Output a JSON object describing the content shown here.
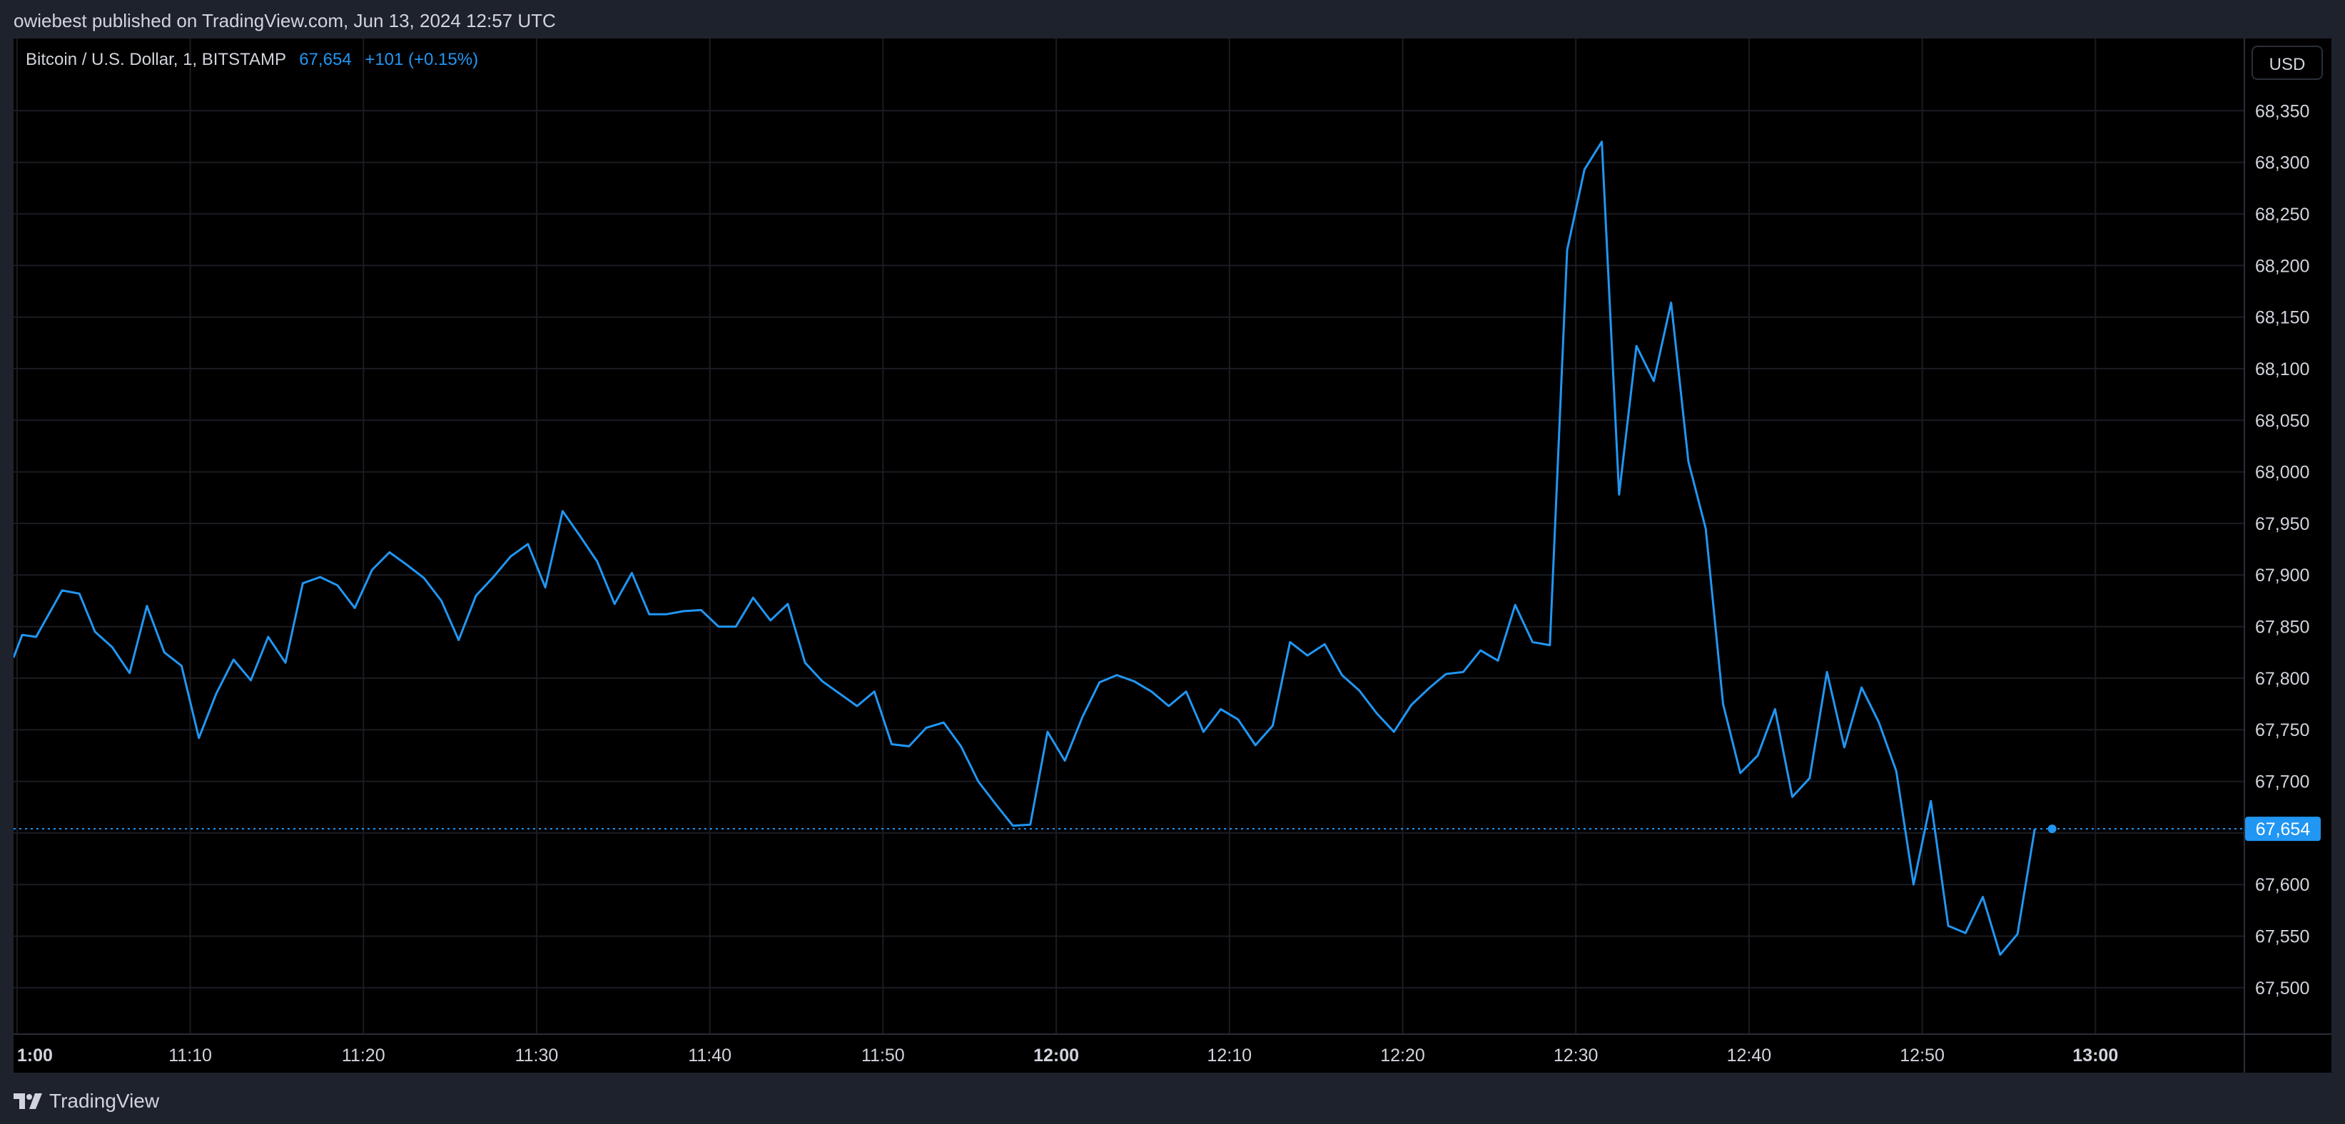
{
  "header": {
    "publish_line": "owiebest published on TradingView.com, Jun 13, 2024 12:57 UTC"
  },
  "legend": {
    "symbol": "Bitcoin / U.S. Dollar, 1, BITSTAMP",
    "price": "67,654",
    "change": "+101 (+0.15%)"
  },
  "currency_button": {
    "label": "USD"
  },
  "footer": {
    "brand": "TradingView"
  },
  "colors": {
    "line": "#2196f3",
    "price_tag_bg": "#2196f3",
    "background": "#000000",
    "frame": "#1e222d",
    "grid": "#1a1c22"
  },
  "chart_data": {
    "type": "line",
    "ylim": [
      67455,
      68420
    ],
    "x_tick_labels": [
      {
        "t": 0,
        "label": "1:00",
        "bold": true
      },
      {
        "t": 10,
        "label": "11:10",
        "bold": false
      },
      {
        "t": 20,
        "label": "11:20",
        "bold": false
      },
      {
        "t": 30,
        "label": "11:30",
        "bold": false
      },
      {
        "t": 40,
        "label": "11:40",
        "bold": false
      },
      {
        "t": 50,
        "label": "11:50",
        "bold": false
      },
      {
        "t": 60,
        "label": "12:00",
        "bold": true
      },
      {
        "t": 70,
        "label": "12:10",
        "bold": false
      },
      {
        "t": 80,
        "label": "12:20",
        "bold": false
      },
      {
        "t": 90,
        "label": "12:30",
        "bold": false
      },
      {
        "t": 100,
        "label": "12:40",
        "bold": false
      },
      {
        "t": 110,
        "label": "12:50",
        "bold": false
      },
      {
        "t": 120,
        "label": "13:00",
        "bold": true
      }
    ],
    "y_ticks": [
      67500,
      67550,
      67600,
      67700,
      67750,
      67800,
      67850,
      67900,
      67950,
      68000,
      68050,
      68100,
      68150,
      68200,
      68250,
      68300,
      68350
    ],
    "y_tick_labels": [
      "67,500",
      "67,550",
      "67,600",
      "67,700",
      "67,750",
      "67,800",
      "67,850",
      "67,900",
      "67,950",
      "68,000",
      "68,050",
      "68,100",
      "68,150",
      "68,200",
      "68,250",
      "68,300",
      "68,350"
    ],
    "last_price": 67654,
    "last_price_label": "67,654",
    "x": [
      -0.2,
      0.3,
      1.1,
      2.6,
      3.6,
      4.5,
      5.5,
      6.5,
      7.5,
      8.5,
      9.5,
      10.5,
      11.5,
      12.5,
      13.5,
      14.5,
      15.5,
      16.5,
      17.5,
      18.5,
      19.5,
      20.5,
      21.5,
      22.5,
      23.5,
      24.5,
      25.5,
      26.5,
      27.5,
      28.5,
      29.5,
      30.5,
      31.5,
      32.5,
      33.5,
      34.5,
      35.5,
      36.5,
      37.5,
      38.5,
      39.5,
      40.5,
      41.5,
      42.5,
      43.5,
      44.5,
      45.5,
      46.5,
      47.5,
      48.5,
      49.5,
      50.5,
      51.5,
      52.5,
      53.5,
      54.5,
      55.5,
      56.5,
      57.5,
      58.5,
      59.5,
      60.5,
      61.5,
      62.5,
      63.5,
      64.5,
      65.5,
      66.5,
      67.5,
      68.5,
      69.5,
      70.5,
      71.5,
      72.5,
      73.5,
      74.5,
      75.5,
      76.5,
      77.5,
      78.5,
      79.5,
      80.5,
      81.5,
      82.5,
      83.5,
      84.5,
      85.5,
      86.5,
      87.5,
      88.5,
      89.5,
      90.5,
      91.5,
      92.5,
      93.5,
      94.5,
      95.5,
      96.5,
      97.5,
      98.5,
      99.5,
      100.5,
      101.5,
      102.5,
      103.5,
      104.5,
      105.5,
      106.5,
      107.5,
      108.5,
      109.5,
      110.5,
      111.5,
      112.5,
      113.5,
      114.5,
      115.5,
      116.5,
      117.5
    ],
    "y": [
      67820,
      67842,
      67840,
      67885,
      67882,
      67845,
      67830,
      67805,
      67870,
      67825,
      67812,
      67742,
      67785,
      67818,
      67798,
      67840,
      67815,
      67892,
      67898,
      67890,
      67868,
      67905,
      67922,
      67910,
      67897,
      67875,
      67837,
      67880,
      67898,
      67918,
      67930,
      67888,
      67962,
      67938,
      67913,
      67872,
      67902,
      67862,
      67862,
      67865,
      67866,
      67850,
      67850,
      67878,
      67856,
      67872,
      67815,
      67797,
      67785,
      67773,
      67787,
      67736,
      67734,
      67752,
      67757,
      67734,
      67700,
      67678,
      67657,
      67658,
      67748,
      67720,
      67762,
      67796,
      67803,
      67797,
      67787,
      67773,
      67787,
      67748,
      67770,
      67760,
      67735,
      67754,
      67835,
      67822,
      67833,
      67803,
      67788,
      67766,
      67748,
      67774,
      67790,
      67804,
      67806,
      67827,
      67817,
      67871,
      67835,
      67832,
      68215,
      68293,
      68320,
      67978,
      68122,
      68088,
      68164,
      68010,
      67945,
      67775,
      67708,
      67725,
      67770,
      67685,
      67703,
      67806,
      67733,
      67791,
      67757,
      67710,
      67600,
      67681,
      67560,
      67553,
      67588,
      67532,
      67552,
      67654
    ]
  }
}
